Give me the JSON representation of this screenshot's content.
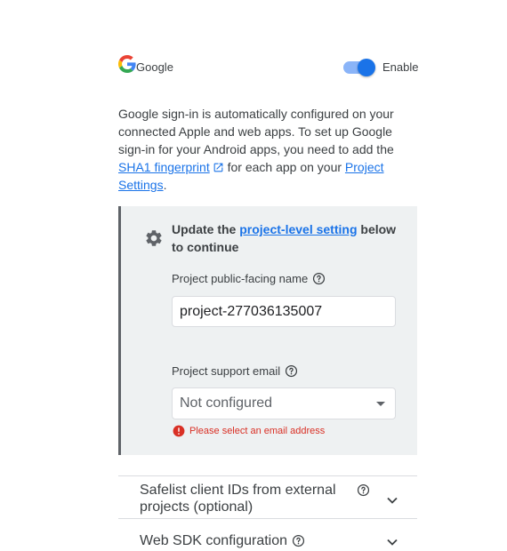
{
  "provider": {
    "name": "Google",
    "icon": "google-g-icon",
    "enabled": true,
    "toggle_label": "Enable"
  },
  "description": {
    "text_1": "Google sign-in is automatically configured on your connected Apple and web apps. To set up Google sign-in for your Android apps, you need to add the ",
    "sha1_link": "SHA1 fingerprint",
    "text_2": " for each app on your ",
    "settings_link": "Project Settings",
    "text_3": "."
  },
  "panel": {
    "title_1": "Update the ",
    "title_link": "project-level setting",
    "title_2": " below to continue",
    "name_label": "Project public-facing name",
    "name_value": "project-277036135007",
    "email_label": "Project support email",
    "email_value": "Not configured",
    "error": "Please select an email address"
  },
  "accordions": [
    {
      "label": "Safelist client IDs from external projects (optional)"
    },
    {
      "label": "Web SDK configuration"
    }
  ],
  "colors": {
    "accent": "#1a73e8",
    "error": "#d93025",
    "panel_bg": "#eef1f2"
  }
}
